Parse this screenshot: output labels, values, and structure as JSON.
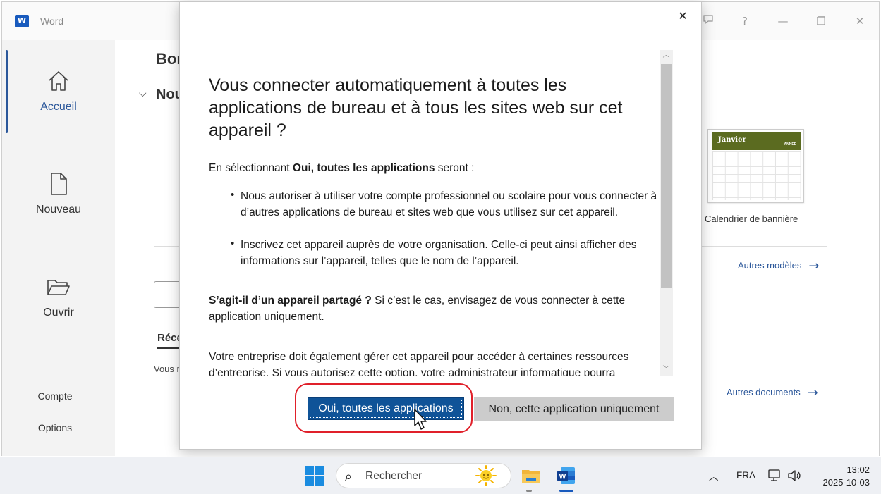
{
  "window": {
    "app_name": "Word",
    "app_badge": "W"
  },
  "nav": {
    "home_label": "Accueil",
    "new_label": "Nouveau",
    "open_label": "Ouvrir",
    "account_label": "Compte",
    "options_label": "Options"
  },
  "content": {
    "greeting_partial": "Bon",
    "new_heading_partial": "Nou",
    "recent_tab_partial": "Réce",
    "recent_empty_partial": "Vous n",
    "template": {
      "month": "Janvier",
      "year_label": "ANNÉE",
      "caption": "Calendrier de bannière",
      "band_color": "#5b6b20"
    },
    "more_templates": "Autres modèles",
    "more_documents": "Autres documents"
  },
  "dialog": {
    "title": "Vous connecter automatiquement à toutes les applications de bureau et à tous les sites web sur cet appareil ?",
    "intro_prefix": "En sélectionnant ",
    "intro_bold": "Oui, toutes les applications",
    "intro_suffix": " seront :",
    "bullets": [
      "Nous autoriser à utiliser votre compte professionnel ou scolaire pour vous connecter à d’autres applications de bureau et sites web que vous utilisez sur cet appareil.",
      "Inscrivez cet appareil auprès de votre organisation. Celle-ci peut ainsi afficher des informations sur l’appareil, telles que le nom de l’appareil."
    ],
    "shared_bold": "S’agit-il d’un appareil partagé ?",
    "shared_text": " Si c’est le cas, envisagez de vous connecter à cette application uniquement.",
    "manage_text": "Votre entreprise doit également gérer cet appareil pour accéder à certaines ressources d’entreprise. Si vous autorisez cette option, votre administrateur informatique pourra",
    "yes_button": "Oui, toutes les applications",
    "no_button": "Non, cette application uniquement",
    "close_glyph": "✕",
    "highlight_color": "#e0202a",
    "primary_color": "#0f5398"
  },
  "taskbar": {
    "search_placeholder": "Rechercher",
    "language": "FRA",
    "time": "13:02",
    "date": "2025-10-03"
  }
}
